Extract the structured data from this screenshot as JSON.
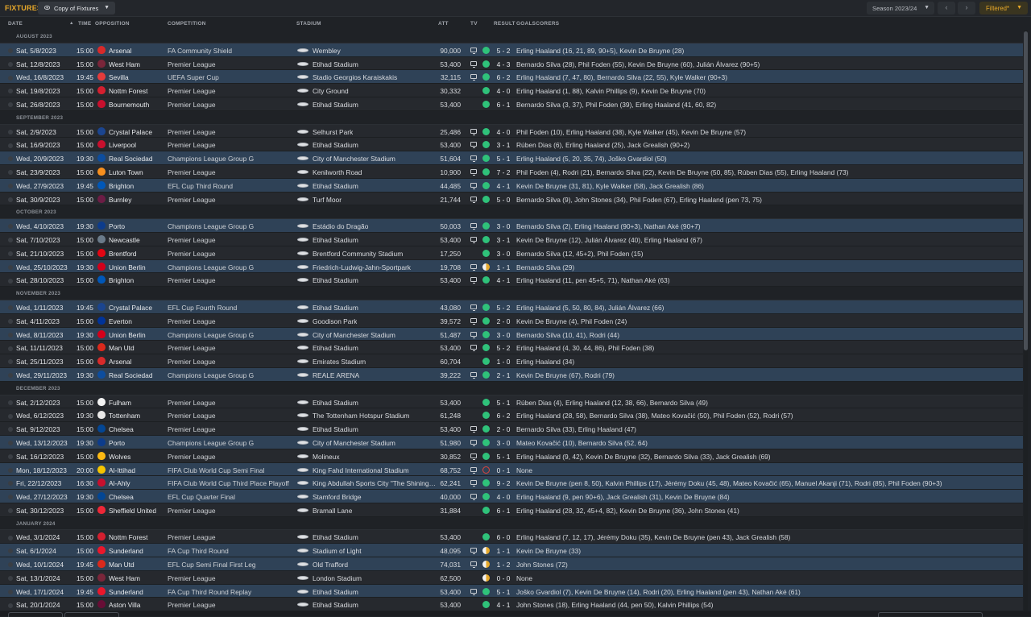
{
  "header": {
    "title": "FIXTURES",
    "view_label": "Copy of Fixtures",
    "season_label": "Season 2023/24",
    "filter_label": "Filtered*"
  },
  "columns": {
    "date": "DATE",
    "sort_arrow": "▲",
    "time": "TIME",
    "opposition": "OPPOSITION",
    "competition": "COMPETITION",
    "stadium": "STADIUM",
    "att": "ATT",
    "tv": "TV",
    "result": "RESULT",
    "goalscorers": "GOALSCORERS"
  },
  "colors": {
    "accent": "#e8a92a",
    "home_row": "#2f4257",
    "away_row": "#26292e",
    "win": "#2fc27a",
    "draw": "#e6a92c",
    "loss": "#e0443c"
  },
  "groups": [
    {
      "month": "AUGUST 2023",
      "fixtures": [
        {
          "date": "Sat, 5/8/2023",
          "time": "15:00",
          "opp": "Arsenal",
          "comp": "FA Community Shield",
          "stadium": "Wembley",
          "att": "90,000",
          "tv": true,
          "res": "W",
          "score": "5 - 2",
          "scorers": "Erling Haaland (16, 21, 89, 90+5), Kevin De Bruyne (28)",
          "home": true,
          "crest": "#d82a2a"
        },
        {
          "date": "Sat, 12/8/2023",
          "time": "15:00",
          "opp": "West Ham",
          "comp": "Premier League",
          "stadium": "Etihad Stadium",
          "att": "53,400",
          "tv": true,
          "res": "W",
          "score": "4 - 3",
          "scorers": "Bernardo Silva (28), Phil Foden (55), Kevin De Bruyne (60), Julián Álvarez (90+5)",
          "home": false,
          "crest": "#7a263a"
        },
        {
          "date": "Wed, 16/8/2023",
          "time": "19:45",
          "opp": "Sevilla",
          "comp": "UEFA Super Cup",
          "stadium": "Stadio Georgios Karaiskakis",
          "att": "32,115",
          "tv": true,
          "res": "W",
          "score": "6 - 2",
          "scorers": "Erling Haaland (7, 47, 80), Bernardo Silva (22, 55), Kyle Walker (90+3)",
          "home": true,
          "crest": "#e43b3b"
        },
        {
          "date": "Sat, 19/8/2023",
          "time": "15:00",
          "opp": "Nottm Forest",
          "comp": "Premier League",
          "stadium": "City Ground",
          "att": "30,332",
          "tv": false,
          "res": "W",
          "score": "4 - 0",
          "scorers": "Erling Haaland (1, 88), Kalvin Phillips (9), Kevin De Bruyne (70)",
          "home": false,
          "crest": "#d41f2f"
        },
        {
          "date": "Sat, 26/8/2023",
          "time": "15:00",
          "opp": "Bournemouth",
          "comp": "Premier League",
          "stadium": "Etihad Stadium",
          "att": "53,400",
          "tv": false,
          "res": "W",
          "score": "6 - 1",
          "scorers": "Bernardo Silva (3, 37), Phil Foden (39), Erling Haaland (41, 60, 82)",
          "home": false,
          "crest": "#c8102e"
        }
      ]
    },
    {
      "month": "SEPTEMBER 2023",
      "fixtures": [
        {
          "date": "Sat, 2/9/2023",
          "time": "15:00",
          "opp": "Crystal Palace",
          "comp": "Premier League",
          "stadium": "Selhurst Park",
          "att": "25,486",
          "tv": true,
          "res": "W",
          "score": "4 - 0",
          "scorers": "Phil Foden (10), Erling Haaland (38), Kyle Walker (45), Kevin De Bruyne (57)",
          "home": false,
          "crest": "#1b458f"
        },
        {
          "date": "Sat, 16/9/2023",
          "time": "15:00",
          "opp": "Liverpool",
          "comp": "Premier League",
          "stadium": "Etihad Stadium",
          "att": "53,400",
          "tv": true,
          "res": "W",
          "score": "3 - 1",
          "scorers": "Rúben Dias (6), Erling Haaland (25), Jack Grealish (90+2)",
          "home": false,
          "crest": "#c8102e"
        },
        {
          "date": "Wed, 20/9/2023",
          "time": "19:30",
          "opp": "Real Sociedad",
          "comp": "Champions League Group G",
          "stadium": "City of Manchester Stadium",
          "att": "51,604",
          "tv": true,
          "res": "W",
          "score": "5 - 1",
          "scorers": "Erling Haaland (5, 20, 35, 74), Joško Gvardiol (50)",
          "home": true,
          "crest": "#0d4d9e"
        },
        {
          "date": "Sat, 23/9/2023",
          "time": "15:00",
          "opp": "Luton Town",
          "comp": "Premier League",
          "stadium": "Kenilworth Road",
          "att": "10,900",
          "tv": true,
          "res": "W",
          "score": "7 - 2",
          "scorers": "Phil Foden (4), Rodri (21), Bernardo Silva (22), Kevin De Bruyne (50, 85), Rúben Dias (55), Erling Haaland (73)",
          "home": false,
          "crest": "#f78f1e"
        },
        {
          "date": "Wed, 27/9/2023",
          "time": "19:45",
          "opp": "Brighton",
          "comp": "EFL Cup Third Round",
          "stadium": "Etihad Stadium",
          "att": "44,485",
          "tv": true,
          "res": "W",
          "score": "4 - 1",
          "scorers": "Kevin De Bruyne (31, 81), Kyle Walker (58), Jack Grealish (86)",
          "home": true,
          "crest": "#0057b8"
        },
        {
          "date": "Sat, 30/9/2023",
          "time": "15:00",
          "opp": "Burnley",
          "comp": "Premier League",
          "stadium": "Turf Moor",
          "att": "21,744",
          "tv": true,
          "res": "W",
          "score": "5 - 0",
          "scorers": "Bernardo Silva (9), John Stones (34), Phil Foden (67), Erling Haaland (pen 73, 75)",
          "home": false,
          "crest": "#6c1d45"
        }
      ]
    },
    {
      "month": "OCTOBER 2023",
      "fixtures": [
        {
          "date": "Wed, 4/10/2023",
          "time": "19:30",
          "opp": "Porto",
          "comp": "Champions League Group G",
          "stadium": "Estádio do Dragão",
          "att": "50,003",
          "tv": true,
          "res": "W",
          "score": "3 - 0",
          "scorers": "Bernardo Silva (2), Erling Haaland (90+3), Nathan Aké (90+7)",
          "home": true,
          "crest": "#0d3c8c"
        },
        {
          "date": "Sat, 7/10/2023",
          "time": "15:00",
          "opp": "Newcastle",
          "comp": "Premier League",
          "stadium": "Etihad Stadium",
          "att": "53,400",
          "tv": true,
          "res": "W",
          "score": "3 - 1",
          "scorers": "Kevin De Bruyne (12), Julián Álvarez (40), Erling Haaland (67)",
          "home": false,
          "crest": "#6b7b8a"
        },
        {
          "date": "Sat, 21/10/2023",
          "time": "15:00",
          "opp": "Brentford",
          "comp": "Premier League",
          "stadium": "Brentford Community Stadium",
          "att": "17,250",
          "tv": false,
          "res": "W",
          "score": "3 - 0",
          "scorers": "Bernardo Silva (12, 45+2), Phil Foden (15)",
          "home": false,
          "crest": "#e30613"
        },
        {
          "date": "Wed, 25/10/2023",
          "time": "19:30",
          "opp": "Union Berlin",
          "comp": "Champions League Group G",
          "stadium": "Friedrich-Ludwig-Jahn-Sportpark",
          "att": "19,708",
          "tv": true,
          "res": "D",
          "score": "1 - 1",
          "scorers": "Bernardo Silva (29)",
          "home": true,
          "crest": "#d4001a"
        },
        {
          "date": "Sat, 28/10/2023",
          "time": "15:00",
          "opp": "Brighton",
          "comp": "Premier League",
          "stadium": "Etihad Stadium",
          "att": "53,400",
          "tv": true,
          "res": "W",
          "score": "4 - 1",
          "scorers": "Erling Haaland (11, pen 45+5, 71), Nathan Aké (63)",
          "home": false,
          "crest": "#0057b8"
        }
      ]
    },
    {
      "month": "NOVEMBER 2023",
      "fixtures": [
        {
          "date": "Wed, 1/11/2023",
          "time": "19:45",
          "opp": "Crystal Palace",
          "comp": "EFL Cup Fourth Round",
          "stadium": "Etihad Stadium",
          "att": "43,080",
          "tv": true,
          "res": "W",
          "score": "5 - 2",
          "scorers": "Erling Haaland (5, 50, 80, 84), Julián Álvarez (66)",
          "home": true,
          "crest": "#1b458f"
        },
        {
          "date": "Sat, 4/11/2023",
          "time": "15:00",
          "opp": "Everton",
          "comp": "Premier League",
          "stadium": "Goodison Park",
          "att": "39,572",
          "tv": true,
          "res": "W",
          "score": "2 - 0",
          "scorers": "Kevin De Bruyne (4), Phil Foden (24)",
          "home": false,
          "crest": "#003399"
        },
        {
          "date": "Wed, 8/11/2023",
          "time": "19:30",
          "opp": "Union Berlin",
          "comp": "Champions League Group G",
          "stadium": "City of Manchester Stadium",
          "att": "51,487",
          "tv": true,
          "res": "W",
          "score": "3 - 0",
          "scorers": "Bernardo Silva (10, 41), Rodri (44)",
          "home": true,
          "crest": "#d4001a"
        },
        {
          "date": "Sat, 11/11/2023",
          "time": "15:00",
          "opp": "Man Utd",
          "comp": "Premier League",
          "stadium": "Etihad Stadium",
          "att": "53,400",
          "tv": true,
          "res": "W",
          "score": "5 - 2",
          "scorers": "Erling Haaland (4, 30, 44, 86), Phil Foden (38)",
          "home": false,
          "crest": "#da291c"
        },
        {
          "date": "Sat, 25/11/2023",
          "time": "15:00",
          "opp": "Arsenal",
          "comp": "Premier League",
          "stadium": "Emirates Stadium",
          "att": "60,704",
          "tv": false,
          "res": "W",
          "score": "1 - 0",
          "scorers": "Erling Haaland (34)",
          "home": false,
          "crest": "#d82a2a"
        },
        {
          "date": "Wed, 29/11/2023",
          "time": "19:30",
          "opp": "Real Sociedad",
          "comp": "Champions League Group G",
          "stadium": "REALE ARENA",
          "att": "39,222",
          "tv": true,
          "res": "W",
          "score": "2 - 1",
          "scorers": "Kevin De Bruyne (67), Rodri (79)",
          "home": true,
          "crest": "#0d4d9e"
        }
      ]
    },
    {
      "month": "DECEMBER 2023",
      "fixtures": [
        {
          "date": "Sat, 2/12/2023",
          "time": "15:00",
          "opp": "Fulham",
          "comp": "Premier League",
          "stadium": "Etihad Stadium",
          "att": "53,400",
          "tv": false,
          "res": "W",
          "score": "5 - 1",
          "scorers": "Rúben Dias (4), Erling Haaland (12, 38, 66), Bernardo Silva (49)",
          "home": false,
          "crest": "#f2f2f2"
        },
        {
          "date": "Wed, 6/12/2023",
          "time": "19:30",
          "opp": "Tottenham",
          "comp": "Premier League",
          "stadium": "The Tottenham Hotspur Stadium",
          "att": "61,248",
          "tv": false,
          "res": "W",
          "score": "6 - 2",
          "scorers": "Erling Haaland (28, 58), Bernardo Silva (38), Mateo Kovačić (50), Phil Foden (52), Rodri (57)",
          "home": false,
          "crest": "#e8e8e8"
        },
        {
          "date": "Sat, 9/12/2023",
          "time": "15:00",
          "opp": "Chelsea",
          "comp": "Premier League",
          "stadium": "Etihad Stadium",
          "att": "53,400",
          "tv": true,
          "res": "W",
          "score": "2 - 0",
          "scorers": "Bernardo Silva (33), Erling Haaland (47)",
          "home": false,
          "crest": "#034694"
        },
        {
          "date": "Wed, 13/12/2023",
          "time": "19:30",
          "opp": "Porto",
          "comp": "Champions League Group G",
          "stadium": "City of Manchester Stadium",
          "att": "51,980",
          "tv": true,
          "res": "W",
          "score": "3 - 0",
          "scorers": "Mateo Kovačić (10), Bernardo Silva (52, 64)",
          "home": true,
          "crest": "#0d3c8c"
        },
        {
          "date": "Sat, 16/12/2023",
          "time": "15:00",
          "opp": "Wolves",
          "comp": "Premier League",
          "stadium": "Molineux",
          "att": "30,852",
          "tv": true,
          "res": "W",
          "score": "5 - 1",
          "scorers": "Erling Haaland (9, 42), Kevin De Bruyne (32), Bernardo Silva (33), Jack Grealish (69)",
          "home": false,
          "crest": "#fdb913"
        },
        {
          "date": "Mon, 18/12/2023",
          "time": "20:00",
          "opp": "Al-Ittihad",
          "comp": "FIFA Club World Cup Semi Final",
          "stadium": "King Fahd International Stadium",
          "att": "68,752",
          "tv": true,
          "res": "L",
          "score": "0 - 1",
          "scorers": "None",
          "home": true,
          "crest": "#f5c400"
        },
        {
          "date": "Fri, 22/12/2023",
          "time": "16:30",
          "opp": "Al-Ahly",
          "comp": "FIFA Club World Cup Third Place Playoff",
          "stadium": "King Abdullah Sports City \"The Shining Jewel\"",
          "att": "62,241",
          "tv": true,
          "res": "W",
          "score": "9 - 2",
          "scorers": "Kevin De Bruyne (pen 8, 50), Kalvin Phillips (17), Jérémy Doku (45, 48), Mateo Kovačić (65), Manuel Akanji (71), Rodri (85), Phil Foden (90+3)",
          "home": true,
          "crest": "#c8102e"
        },
        {
          "date": "Wed, 27/12/2023",
          "time": "19:30",
          "opp": "Chelsea",
          "comp": "EFL Cup Quarter Final",
          "stadium": "Stamford Bridge",
          "att": "40,000",
          "tv": true,
          "res": "W",
          "score": "4 - 0",
          "scorers": "Erling Haaland (9, pen 90+6), Jack Grealish (31), Kevin De Bruyne (84)",
          "home": true,
          "crest": "#034694"
        },
        {
          "date": "Sat, 30/12/2023",
          "time": "15:00",
          "opp": "Sheffield United",
          "comp": "Premier League",
          "stadium": "Bramall Lane",
          "att": "31,884",
          "tv": false,
          "res": "W",
          "score": "6 - 1",
          "scorers": "Erling Haaland (28, 32, 45+4, 82), Kevin De Bruyne (36), John Stones (41)",
          "home": false,
          "crest": "#ee2737"
        }
      ]
    },
    {
      "month": "JANUARY 2024",
      "fixtures": [
        {
          "date": "Wed, 3/1/2024",
          "time": "15:00",
          "opp": "Nottm Forest",
          "comp": "Premier League",
          "stadium": "Etihad Stadium",
          "att": "53,400",
          "tv": false,
          "res": "W",
          "score": "6 - 0",
          "scorers": "Erling Haaland (7, 12, 17), Jérémy Doku (35), Kevin De Bruyne (pen 43), Jack Grealish (58)",
          "home": false,
          "crest": "#d41f2f"
        },
        {
          "date": "Sat, 6/1/2024",
          "time": "15:00",
          "opp": "Sunderland",
          "comp": "FA Cup Third Round",
          "stadium": "Stadium of Light",
          "att": "48,095",
          "tv": true,
          "res": "D",
          "score": "1 - 1",
          "scorers": "Kevin De Bruyne (33)",
          "home": true,
          "crest": "#eb172b"
        },
        {
          "date": "Wed, 10/1/2024",
          "time": "19:45",
          "opp": "Man Utd",
          "comp": "EFL Cup Semi Final First Leg",
          "stadium": "Old Trafford",
          "att": "74,031",
          "tv": true,
          "res": "D",
          "score": "1 - 2",
          "scorers": "John Stones (72)",
          "home": true,
          "crest": "#da291c"
        },
        {
          "date": "Sat, 13/1/2024",
          "time": "15:00",
          "opp": "West Ham",
          "comp": "Premier League",
          "stadium": "London Stadium",
          "att": "62,500",
          "tv": false,
          "res": "D",
          "score": "0 - 0",
          "scorers": "None",
          "home": false,
          "crest": "#7a263a"
        },
        {
          "date": "Wed, 17/1/2024",
          "time": "19:45",
          "opp": "Sunderland",
          "comp": "FA Cup Third Round Replay",
          "stadium": "Etihad Stadium",
          "att": "53,400",
          "tv": true,
          "res": "W",
          "score": "5 - 1",
          "scorers": "Joško Gvardiol (7), Kevin De Bruyne (14), Rodri (20), Erling Haaland (pen 43), Nathan Aké (61)",
          "home": true,
          "crest": "#eb172b"
        },
        {
          "date": "Sat, 20/1/2024",
          "time": "15:00",
          "opp": "Aston Villa",
          "comp": "Premier League",
          "stadium": "Etihad Stadium",
          "att": "53,400",
          "tv": false,
          "res": "W",
          "score": "4 - 1",
          "scorers": "John Stones (18), Erling Haaland (44, pen 50), Kalvin Phillips (54)",
          "home": false,
          "crest": "#670e36"
        }
      ]
    }
  ]
}
